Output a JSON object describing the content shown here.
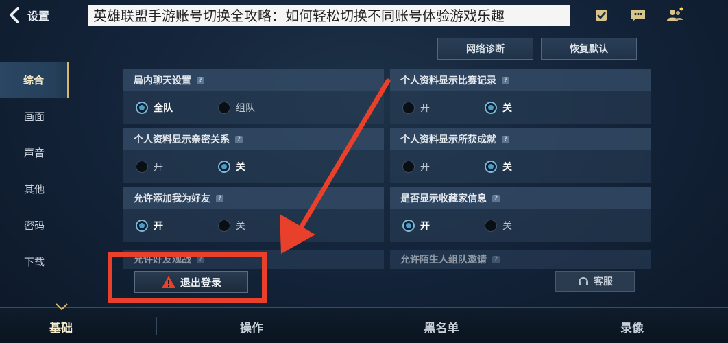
{
  "header": {
    "back_label": "设置",
    "banner_text": "英雄联盟手游账号切换全攻略：如何轻松切换不同账号体验游戏乐趣"
  },
  "sidebar": {
    "items": [
      {
        "label": "综合",
        "active": true
      },
      {
        "label": "画面"
      },
      {
        "label": "声音"
      },
      {
        "label": "其他"
      },
      {
        "label": "密码"
      },
      {
        "label": "下载"
      }
    ]
  },
  "actions": {
    "network_label": "网络诊断",
    "reset_label": "恢复默认"
  },
  "settings": {
    "chat": {
      "title": "局内聊天设置",
      "opt1": "全队",
      "opt2": "组队",
      "selected": "全队"
    },
    "match_record": {
      "title": "个人资料显示比赛记录",
      "opt1": "开",
      "opt2": "关",
      "selected": "关"
    },
    "intimacy": {
      "title": "个人资料显示亲密关系",
      "opt1": "开",
      "opt2": "关",
      "selected": "关"
    },
    "achievements": {
      "title": "个人资料显示所获成就",
      "opt1": "开",
      "opt2": "关",
      "selected": "关"
    },
    "friend_add": {
      "title": "允许添加我为好友",
      "opt1": "开",
      "opt2": "关",
      "selected": "开"
    },
    "collector": {
      "title": "是否显示收藏家信息",
      "opt1": "开",
      "opt2": "关",
      "selected": "开"
    },
    "friend_watch": {
      "title": "允许好友观战"
    },
    "stranger_invite": {
      "title": "允许陌生人组队邀请"
    }
  },
  "logout_label": "退出登录",
  "service_label": "客服",
  "tabs": [
    {
      "label": "基础",
      "active": true
    },
    {
      "label": "操作"
    },
    {
      "label": "黑名单"
    },
    {
      "label": "录像"
    }
  ],
  "colors": {
    "accent_gold": "#d8b870",
    "radio_on": "#4b9ccc",
    "annotation_red": "#e8402a"
  }
}
